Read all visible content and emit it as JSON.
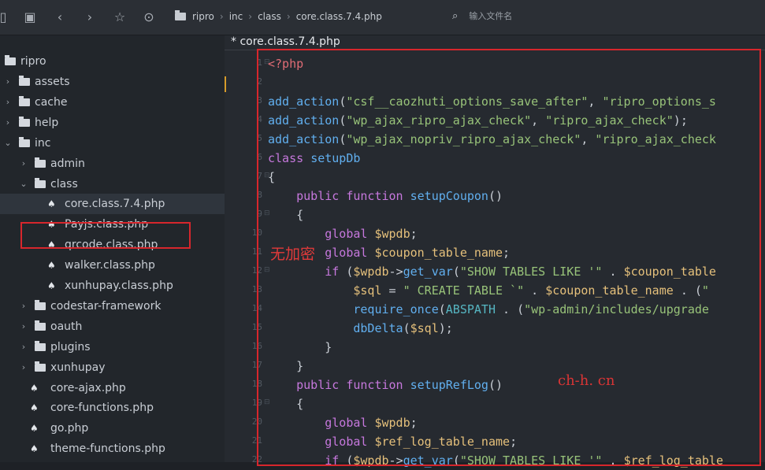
{
  "toolbar": {
    "breadcrumbs": [
      "ripro",
      "inc",
      "class",
      "core.class.7.4.php"
    ],
    "filename_placeholder": "输入文件名"
  },
  "sidebar": {
    "root": "ripro",
    "items": [
      {
        "label": "assets",
        "type": "folder",
        "depth": 1,
        "expanded": false
      },
      {
        "label": "cache",
        "type": "folder",
        "depth": 1,
        "expanded": false
      },
      {
        "label": "help",
        "type": "folder",
        "depth": 1,
        "expanded": false
      },
      {
        "label": "inc",
        "type": "folder",
        "depth": 1,
        "expanded": true
      },
      {
        "label": "admin",
        "type": "folder",
        "depth": 2,
        "expanded": false
      },
      {
        "label": "class",
        "type": "folder",
        "depth": 2,
        "expanded": true
      },
      {
        "label": "core.class.7.4.php",
        "type": "php",
        "depth": 3,
        "active": true
      },
      {
        "label": "Payjs.class.php",
        "type": "php",
        "depth": 3
      },
      {
        "label": "qrcode.class.php",
        "type": "php",
        "depth": 3
      },
      {
        "label": "walker.class.php",
        "type": "php",
        "depth": 3
      },
      {
        "label": "xunhupay.class.php",
        "type": "php",
        "depth": 3
      },
      {
        "label": "codestar-framework",
        "type": "folder",
        "depth": 2,
        "expanded": false
      },
      {
        "label": "oauth",
        "type": "folder",
        "depth": 2,
        "expanded": false
      },
      {
        "label": "plugins",
        "type": "folder",
        "depth": 2,
        "expanded": false
      },
      {
        "label": "xunhupay",
        "type": "folder",
        "depth": 2,
        "expanded": false
      },
      {
        "label": "core-ajax.php",
        "type": "php",
        "depth": 2
      },
      {
        "label": "core-functions.php",
        "type": "php",
        "depth": 2
      },
      {
        "label": "go.php",
        "type": "php",
        "depth": 2
      },
      {
        "label": "theme-functions.php",
        "type": "php",
        "depth": 2
      }
    ]
  },
  "editor": {
    "tab_label": "* core.class.7.4.php",
    "line_numbers": [
      "1",
      "2",
      "3",
      "4",
      "5",
      "6",
      "7",
      "8",
      "9",
      "10",
      "11",
      "12",
      "13",
      "14",
      "15",
      "16",
      "17",
      "18",
      "19",
      "20",
      "21",
      "22"
    ],
    "watermark_left": "无加密",
    "watermark_right": "ch-h. cn"
  },
  "code_lines": [
    "<?php",
    "",
    "add_action(\"csf__caozhuti_options_save_after\", \"ripro_options_s",
    "add_action(\"wp_ajax_ripro_ajax_check\", \"ripro_ajax_check\");",
    "add_action(\"wp_ajax_nopriv_ripro_ajax_check\", \"ripro_ajax_check",
    "class setupDb",
    "{",
    "    public function setupCoupon()",
    "    {",
    "        global $wpdb;",
    "        global $coupon_table_name;",
    "        if ($wpdb->get_var(\"SHOW TABLES LIKE '\" . $coupon_table",
    "            $sql = \" CREATE TABLE `\" . $coupon_table_name . (\"",
    "            require_once(ABSPATH . (\"wp-admin/includes/upgrade",
    "            dbDelta($sql);",
    "        }",
    "    }",
    "    public function setupRefLog()",
    "    {",
    "        global $wpdb;",
    "        global $ref_log_table_name;",
    "        if ($wpdb->get_var(\"SHOW TABLES LIKE '\" . $ref_log_table"
  ]
}
